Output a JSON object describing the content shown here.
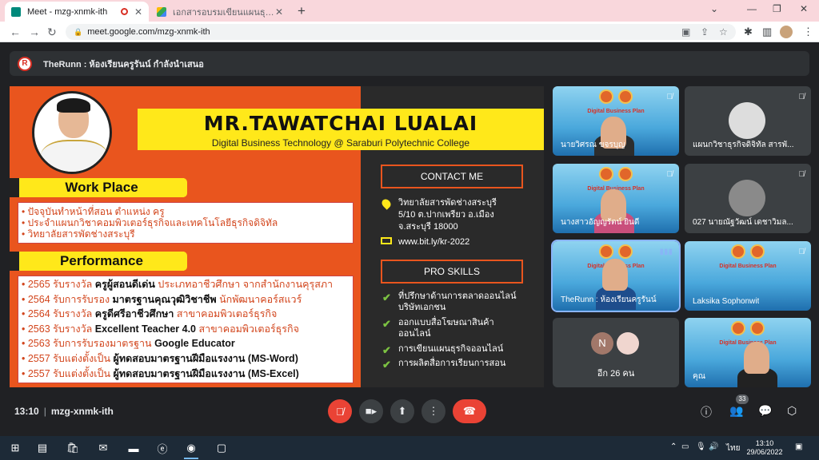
{
  "browser": {
    "tabs": [
      {
        "title": "Meet - mzg-xnmk-ith",
        "active": true
      },
      {
        "title": "เอกสารอบรมเขียนแผนธุรกิจออนไลน์ ใ",
        "active": false
      }
    ],
    "new_tab": "+",
    "url": "meet.google.com/mzg-xnmk-ith"
  },
  "meet": {
    "presenting_text": "TheRunn : ห้องเรียนครูรันน์ กำลังนำเสนอ",
    "presenter_logo_letter": "R",
    "meeting_time": "13:10",
    "meeting_code": "mzg-xnmk-ith",
    "participant_count": "33"
  },
  "slide": {
    "name": "MR.TAWATCHAI  LUALAI",
    "subtitle": "Digital Business Technology @ Saraburi Polytechnic College",
    "work_place_heading": "Work Place",
    "work_place_items": [
      "• ปัจจุบันทำหน้าที่สอน ตำแหน่ง ครู",
      "• ประจำแผนกวิชาคอมพิวเตอร์ธุรกิจและเทคโนโลยีธุรกิจดิจิทัล",
      "• วิทยาลัยสารพัดช่างสระบุรี"
    ],
    "performance_heading": "Performance",
    "performance_items": [
      {
        "pre": "• 2565 รับรางวัล ",
        "bold": "ครูผู้สอนดีเด่น",
        "post": " ประเภทอาชีวศึกษา จากสำนักงานคุรุสภา"
      },
      {
        "pre": "• 2564 รับการรับรอง ",
        "bold": "มาตรฐานคุณวุฒิวิชาชีพ",
        "post": " นักพัฒนาคอร์สแวร์"
      },
      {
        "pre": "• 2564 รับรางวัล ",
        "bold": "ครูดีศรีอาชีวศึกษา",
        "post": " สาขาคอมพิวเตอร์ธุรกิจ"
      },
      {
        "pre": "• 2563 รับรางวัล ",
        "bold": "Excellent Teacher 4.0",
        "post": " สาขาคอมพิวเตอร์ธุรกิจ"
      },
      {
        "pre": "• 2563 รับการรับรองมาตรฐาน ",
        "bold": "Google Educator",
        "post": ""
      },
      {
        "pre": "• 2557 รับแต่งตั้งเป็น ",
        "bold": "ผู้ทดสอบมาตรฐานฝีมือแรงงาน (MS-Word)",
        "post": ""
      },
      {
        "pre": "• 2557 รับแต่งตั้งเป็น ",
        "bold": "ผู้ทดสอบมาตรฐานฝีมือแรงงาน (MS-Excel)",
        "post": ""
      }
    ],
    "contact_heading": "CONTACT ME",
    "address_lines": [
      "วิทยาลัยสารพัดช่างสระบุรี",
      "5/10 ต.ปากเพรียว อ.เมือง",
      "จ.สระบุรี 18000"
    ],
    "website": "www.bit.ly/kr-2022",
    "skills_heading": "PRO SKILLS",
    "skills": [
      [
        "ที่ปรึกษาด้านการตลาดออนไลน์",
        "บริษัทเอกชน"
      ],
      [
        "ออกแบบสื่อโฆษณาสินค้า",
        "ออนไลน์"
      ],
      [
        "การเขียนแผนธุรกิจออนไลน์"
      ],
      [
        "การผลิตสื่อการเรียนการสอน"
      ]
    ]
  },
  "participants": [
    {
      "name": "นายวิศรณ ขจรบุญ",
      "banner": "Digital Business Plan"
    },
    {
      "name": "แผนกวิชาธุรกิจดิจิทัล สารพั..."
    },
    {
      "name": "นางสาวอัญญรัตน์ ยินดี",
      "banner": "Digital Business Plan"
    },
    {
      "name": "027 นายณัฐวัฒน์ เดชาวิมล..."
    },
    {
      "name": "TheRunn : ห้องเรียนครูรันน์",
      "banner": "Digital Business Plan"
    },
    {
      "name": "Laksika Sophonwit",
      "banner": "Digital Business Plan"
    },
    {
      "name": "คุณ",
      "banner": "Digital Business Plan"
    }
  ],
  "others": {
    "initial": "N",
    "label": "อีก 26 คน"
  },
  "taskbar": {
    "time": "13:10",
    "date": "29/06/2022",
    "lang": "ไทย"
  },
  "colors": {
    "slide_orange": "#e9551e",
    "banner_yellow": "#ffe81a",
    "end_call_red": "#ea4335"
  }
}
